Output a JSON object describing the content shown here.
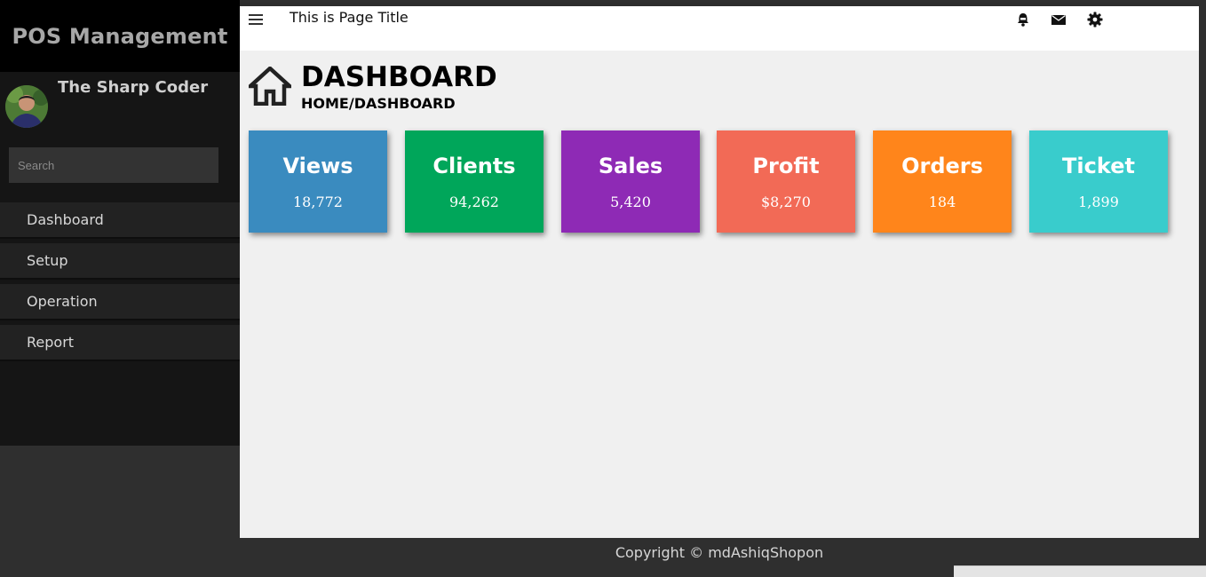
{
  "sidebar": {
    "brand": "POS Management",
    "profile_name": "The Sharp Coder",
    "search_placeholder": "Search",
    "menu": [
      {
        "label": "Dashboard"
      },
      {
        "label": "Setup"
      },
      {
        "label": "Operation"
      },
      {
        "label": "Report"
      }
    ]
  },
  "topbar": {
    "page_title": "This is Page Title",
    "icons": [
      "menu-icon",
      "bell-icon",
      "mail-icon",
      "gear-icon"
    ]
  },
  "main": {
    "heading": "DASHBOARD",
    "breadcrumb": "HOME/DASHBOARD",
    "cards": [
      {
        "title": "Views",
        "value": "18,772",
        "color": "#3a8bbf"
      },
      {
        "title": "Clients",
        "value": "94,262",
        "color": "#00a65a"
      },
      {
        "title": "Sales",
        "value": "5,420",
        "color": "#8e2ab5"
      },
      {
        "title": "Profit",
        "value": "$8,270",
        "color": "#f26a56"
      },
      {
        "title": "Orders",
        "value": "184",
        "color": "#ff851b"
      },
      {
        "title": "Ticket",
        "value": "1,899",
        "color": "#39cccc"
      }
    ]
  },
  "footer": {
    "copyright": "Copyright © mdAshiqShopon"
  }
}
